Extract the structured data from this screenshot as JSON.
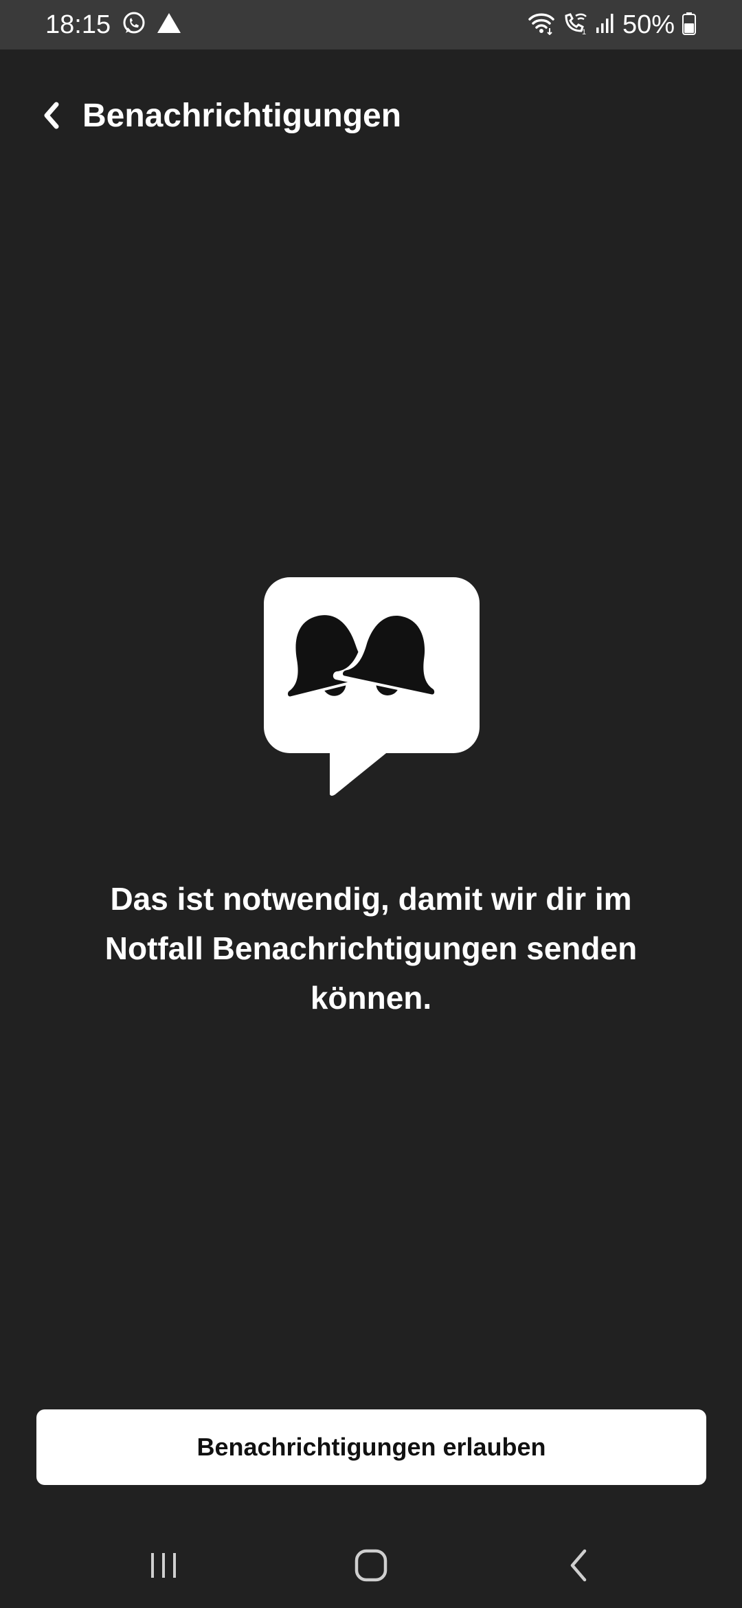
{
  "status_bar": {
    "time": "18:15",
    "battery_percent": "50%",
    "icons_left": [
      "whatsapp-icon",
      "drive-icon"
    ],
    "icons_right": [
      "wifi-icon",
      "wifi-calling-icon",
      "signal-icon",
      "battery-icon"
    ]
  },
  "header": {
    "title": "Benachrichtigungen",
    "back_icon": "chevron-left-icon"
  },
  "illustration": {
    "icon": "notification-bells-speech-bubble-icon"
  },
  "message": {
    "text": "Das ist notwendig, damit wir dir im Notfall Benachrichtigungen senden können."
  },
  "actions": {
    "allow_label": "Benachrichtigungen erlauben"
  },
  "nav_bar": {
    "items": [
      "recent-apps-icon",
      "home-icon",
      "back-icon"
    ]
  },
  "colors": {
    "background": "#212121",
    "status_bar": "#3a3a3a",
    "text": "#ffffff",
    "button_bg": "#ffffff",
    "button_text": "#111111"
  }
}
